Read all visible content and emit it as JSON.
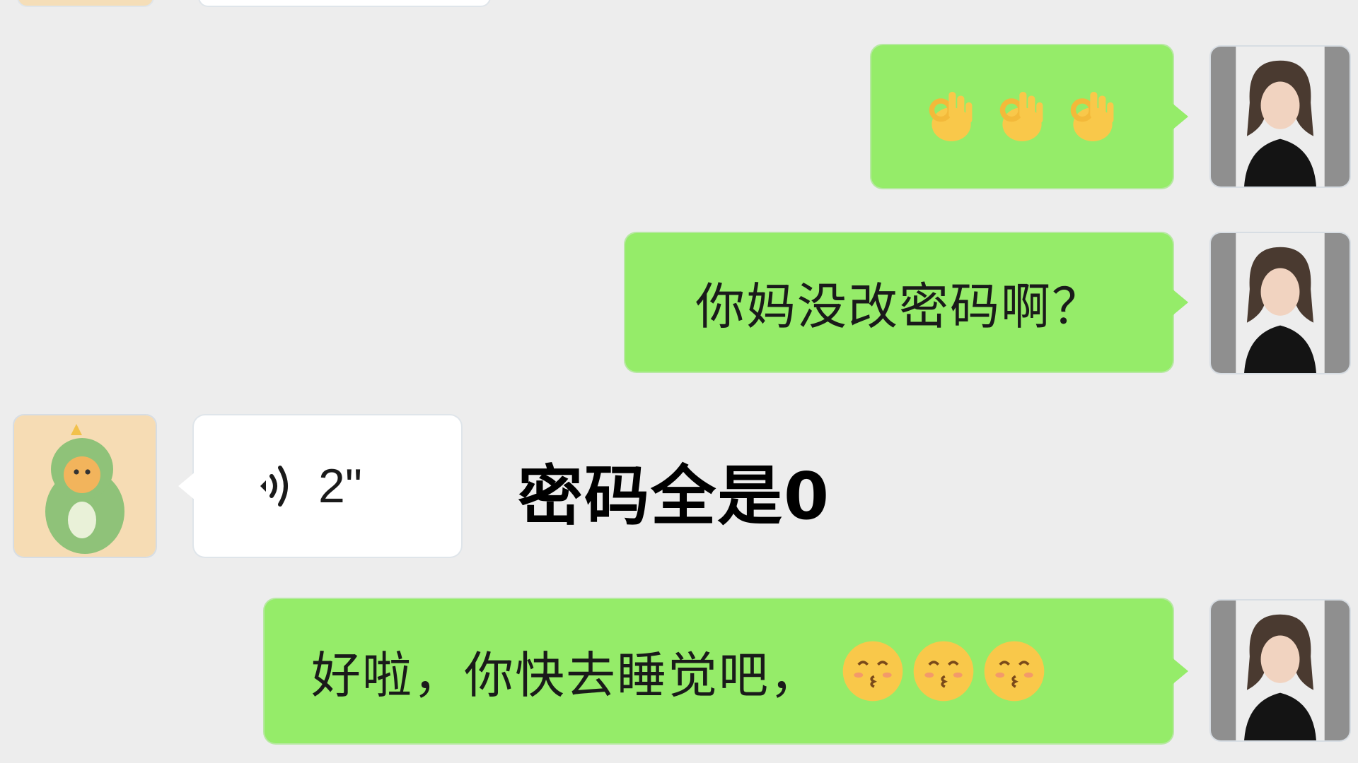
{
  "messages": [
    {
      "sender": "me",
      "type": "emoji",
      "emojis": [
        "ok-hand-icon",
        "ok-hand-icon",
        "ok-hand-icon"
      ]
    },
    {
      "sender": "me",
      "type": "text",
      "text": "你妈没改密码啊？"
    },
    {
      "sender": "other",
      "type": "voice",
      "duration": "2\""
    },
    {
      "sender": "me",
      "type": "text_emoji",
      "text": "好啦，你快去睡觉吧，",
      "emojis": [
        "kissing-face-icon",
        "kissing-face-icon",
        "kissing-face-icon"
      ]
    }
  ],
  "overlay": {
    "caption": "密码全是0"
  },
  "colors": {
    "my_bubble": "#95ec69",
    "other_bubble": "#ffffff",
    "background": "#ededed"
  }
}
